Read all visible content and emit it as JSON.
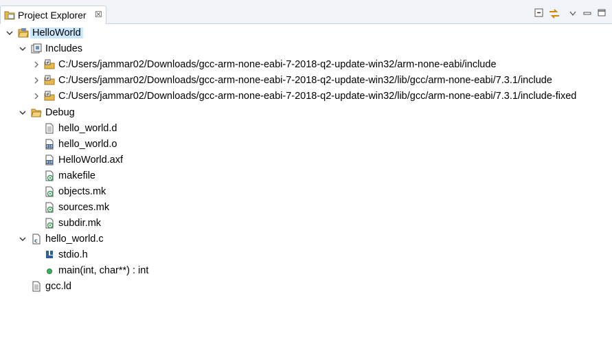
{
  "tab": {
    "title": "Project Explorer",
    "close": "☒"
  },
  "toolbar": {
    "items": [
      "collapse-all",
      "link-with-editor",
      "view-menu",
      "minimize",
      "maximize"
    ]
  },
  "tree": {
    "project": "HelloWorld",
    "includes": {
      "label": "Includes",
      "paths": [
        "C:/Users/jammar02/Downloads/gcc-arm-none-eabi-7-2018-q2-update-win32/arm-none-eabi/include",
        "C:/Users/jammar02/Downloads/gcc-arm-none-eabi-7-2018-q2-update-win32/lib/gcc/arm-none-eabi/7.3.1/include",
        "C:/Users/jammar02/Downloads/gcc-arm-none-eabi-7-2018-q2-update-win32/lib/gcc/arm-none-eabi/7.3.1/include-fixed"
      ]
    },
    "debug": {
      "label": "Debug",
      "files": [
        "hello_world.d",
        "hello_world.o",
        "HelloWorld.axf",
        "makefile",
        "objects.mk",
        "sources.mk",
        "subdir.mk"
      ]
    },
    "source": {
      "label": "hello_world.c",
      "children": [
        "stdio.h",
        "main(int, char**) : int"
      ]
    },
    "linker": "gcc.ld"
  },
  "colors": {
    "selection": "#cce8ff",
    "folder": "#e8b84a",
    "tab_bg": "#f0f4f8"
  }
}
